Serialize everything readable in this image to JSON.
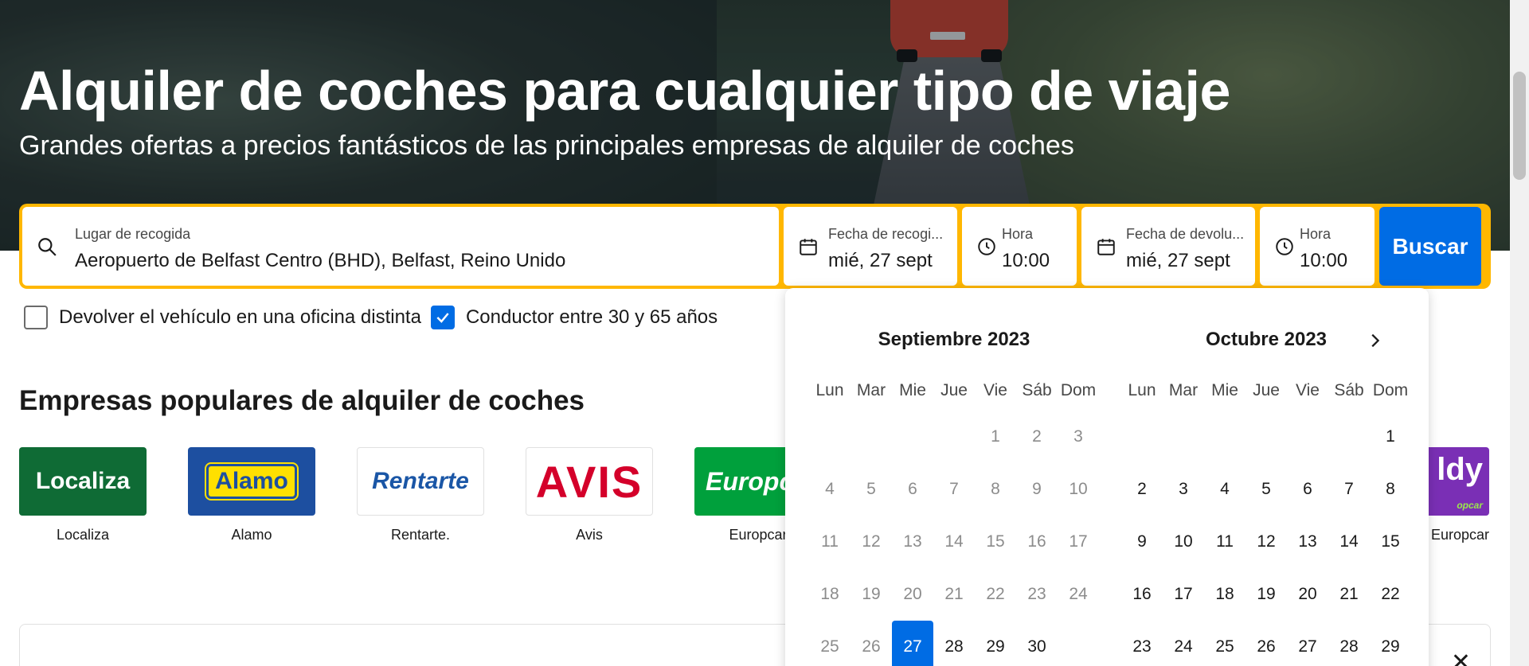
{
  "hero": {
    "title": "Alquiler de coches para cualquier tipo de viaje",
    "subtitle": "Grandes ofertas a precios fantásticos de las principales empresas de alquiler de coches"
  },
  "search": {
    "pickup_label": "Lugar de recogida",
    "pickup_value": "Aeropuerto de Belfast Centro (BHD), Belfast, Reino Unido",
    "pickup_date_label": "Fecha de recogi...",
    "pickup_date_value": "mié, 27 sept",
    "pickup_time_label": "Hora",
    "pickup_time_value": "10:00",
    "return_date_label": "Fecha de devolu...",
    "return_date_value": "mié, 27 sept",
    "return_time_label": "Hora",
    "return_time_value": "10:00",
    "search_button": "Buscar"
  },
  "options": {
    "different_return": {
      "label": "Devolver el vehículo en una oficina distinta",
      "checked": false
    },
    "driver_age": {
      "label": "Conductor entre 30 y 65 años",
      "checked": true
    }
  },
  "popular": {
    "title": "Empresas populares de alquiler de coches",
    "brands": [
      {
        "name": "Localiza",
        "logo_text": "Localiza"
      },
      {
        "name": "Alamo",
        "logo_text": "Alamo"
      },
      {
        "name": "Rentarte.",
        "logo_text": "Rentarte"
      },
      {
        "name": "Avis",
        "logo_text": "AVIS"
      },
      {
        "name": "Europcar",
        "logo_text": "Europc"
      }
    ],
    "right_brand": {
      "name": "Europcar",
      "logo_text": "ldy",
      "logo_sub": "opcar"
    }
  },
  "calendar": {
    "weekdays": [
      "Lun",
      "Mar",
      "Mie",
      "Jue",
      "Vie",
      "Sáb",
      "Dom"
    ],
    "months": [
      {
        "title": "Septiembre 2023",
        "offset": 4,
        "days": [
          "1",
          "2",
          "3",
          "4",
          "5",
          "6",
          "7",
          "8",
          "9",
          "10",
          "11",
          "12",
          "13",
          "14",
          "15",
          "16",
          "17",
          "18",
          "19",
          "20",
          "21",
          "22",
          "23",
          "24",
          "25",
          "26",
          "27",
          "28",
          "29",
          "30"
        ],
        "past_until": 26,
        "selected": 27
      },
      {
        "title": "Octubre 2023",
        "offset": 6,
        "days": [
          "1",
          "2",
          "3",
          "4",
          "5",
          "6",
          "7",
          "8",
          "9",
          "10",
          "11",
          "12",
          "13",
          "14",
          "15",
          "16",
          "17",
          "18",
          "19",
          "20",
          "21",
          "22",
          "23",
          "24",
          "25",
          "26",
          "27",
          "28",
          "29"
        ],
        "past_until": 0,
        "selected": 0
      }
    ]
  },
  "colors": {
    "accent": "#006ce4",
    "searchbar": "#ffb700"
  }
}
